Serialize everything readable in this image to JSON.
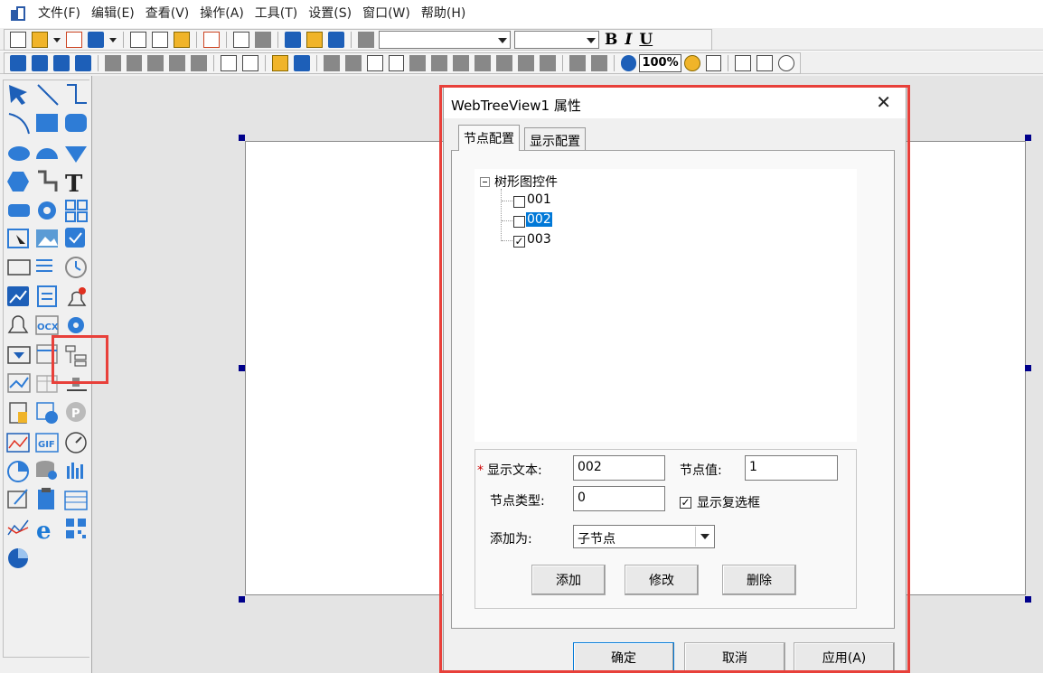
{
  "menubar": {
    "app_icon": "app-icon",
    "items": [
      "文件(F)",
      "编辑(E)",
      "查看(V)",
      "操作(A)",
      "工具(T)",
      "设置(S)",
      "窗口(W)",
      "帮助(H)"
    ]
  },
  "toolbar": {
    "font_name": "",
    "font_size": "",
    "bold": "B",
    "italic": "I",
    "underline": "U",
    "zoom": "100%"
  },
  "dialog": {
    "title": "WebTreeView1 属性",
    "tabs": [
      "节点配置",
      "显示配置"
    ],
    "tree": {
      "root": "树形图控件",
      "nodes": [
        {
          "label": "001",
          "checked": false,
          "selected": false
        },
        {
          "label": "002",
          "checked": false,
          "selected": true
        },
        {
          "label": "003",
          "checked": true,
          "selected": false
        }
      ]
    },
    "form": {
      "required_mark": "*",
      "display_text_label": "显示文本:",
      "display_text_value": "002",
      "node_value_label": "节点值:",
      "node_value_value": "1",
      "node_type_label": "节点类型:",
      "node_type_value": "0",
      "show_checkbox_label": "显示复选框",
      "show_checkbox_checked": true,
      "add_as_label": "添加为:",
      "add_as_value": "子节点"
    },
    "actions": {
      "add": "添加",
      "modify": "修改",
      "delete": "删除"
    },
    "footer": {
      "ok": "确定",
      "cancel": "取消",
      "apply": "应用(A)"
    }
  },
  "colors": {
    "highlight": "#e8403a",
    "selection": "#0078d7"
  }
}
